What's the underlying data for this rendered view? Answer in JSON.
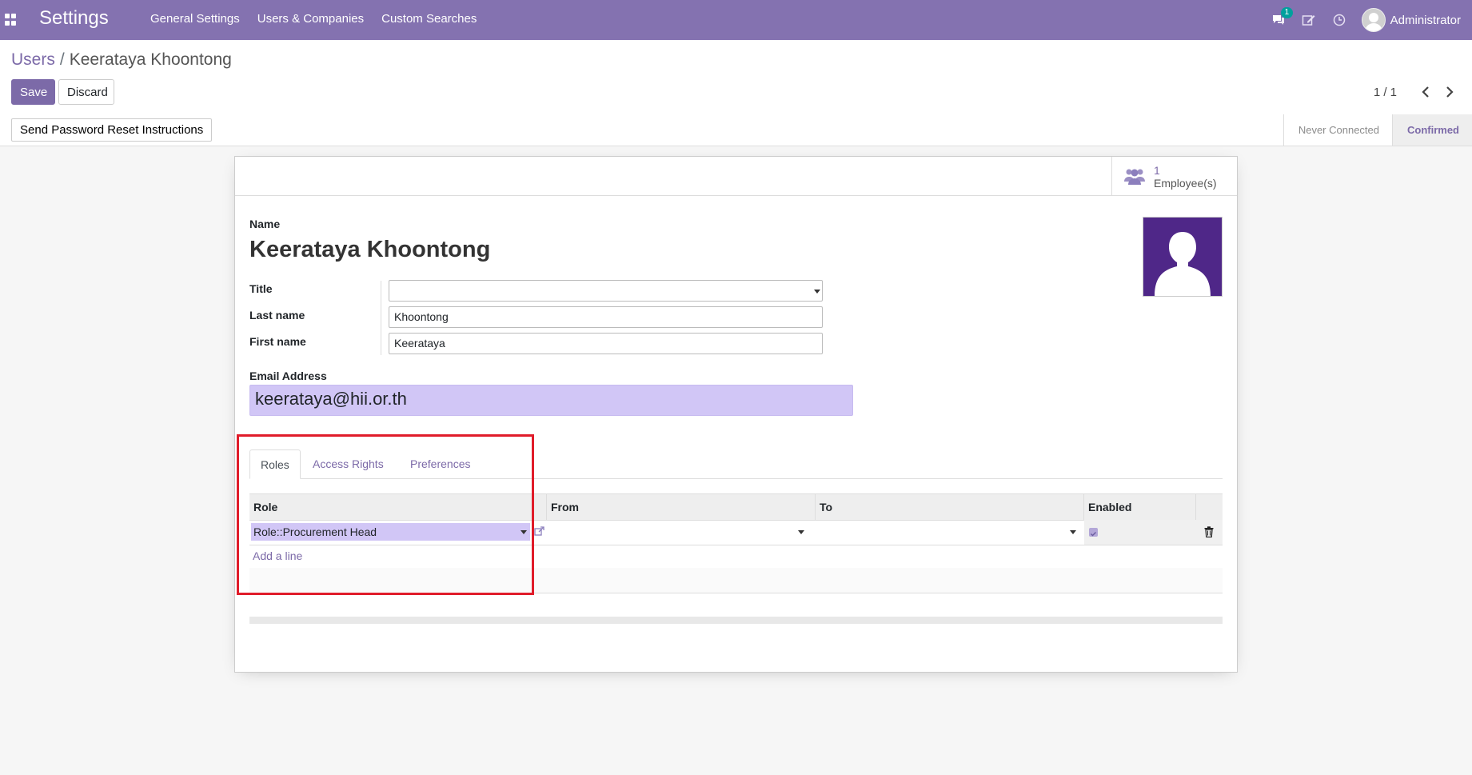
{
  "navbar": {
    "brand": "Settings",
    "menu": [
      "General Settings",
      "Users & Companies",
      "Custom Searches"
    ],
    "messages_badge": "1",
    "user": "Administrator",
    "color": "#8472b0"
  },
  "breadcrumb": {
    "parent": "Users",
    "separator": "/",
    "current": "Keerataya Khoontong"
  },
  "actions": {
    "save": "Save",
    "discard": "Discard"
  },
  "pager": {
    "value": "1 / 1"
  },
  "statusbar": {
    "reset_button": "Send Password Reset Instructions",
    "stages": [
      "Never Connected",
      "Confirmed"
    ],
    "active_stage": "Confirmed"
  },
  "smart_button": {
    "count": "1",
    "label": "Employee(s)"
  },
  "form": {
    "name_label": "Name",
    "name_value": "Keerataya Khoontong",
    "title_label": "Title",
    "title_value": "",
    "last_name_label": "Last name",
    "last_name_value": "Khoontong",
    "first_name_label": "First name",
    "first_name_value": "Keerataya",
    "email_label": "Email Address",
    "email_value": "keerataya@hii.or.th"
  },
  "tabs": [
    "Roles",
    "Access Rights",
    "Preferences"
  ],
  "active_tab": "Roles",
  "roles_table": {
    "columns": [
      "Role",
      "From",
      "To",
      "Enabled"
    ],
    "rows": [
      {
        "role": "Role::Procurement Head",
        "from": "",
        "to": "",
        "enabled": true
      }
    ],
    "add_line": "Add a line"
  },
  "colors": {
    "accent": "#7c6aa8",
    "highlight": "#e01c2a",
    "input_focus": "#d1c6f6"
  },
  "icons": [
    "apps-icon",
    "chat-icon",
    "activity-icon",
    "clock-icon",
    "avatar",
    "users-icon",
    "external-link-icon",
    "trash-icon",
    "chevron-left-icon",
    "chevron-right-icon"
  ]
}
